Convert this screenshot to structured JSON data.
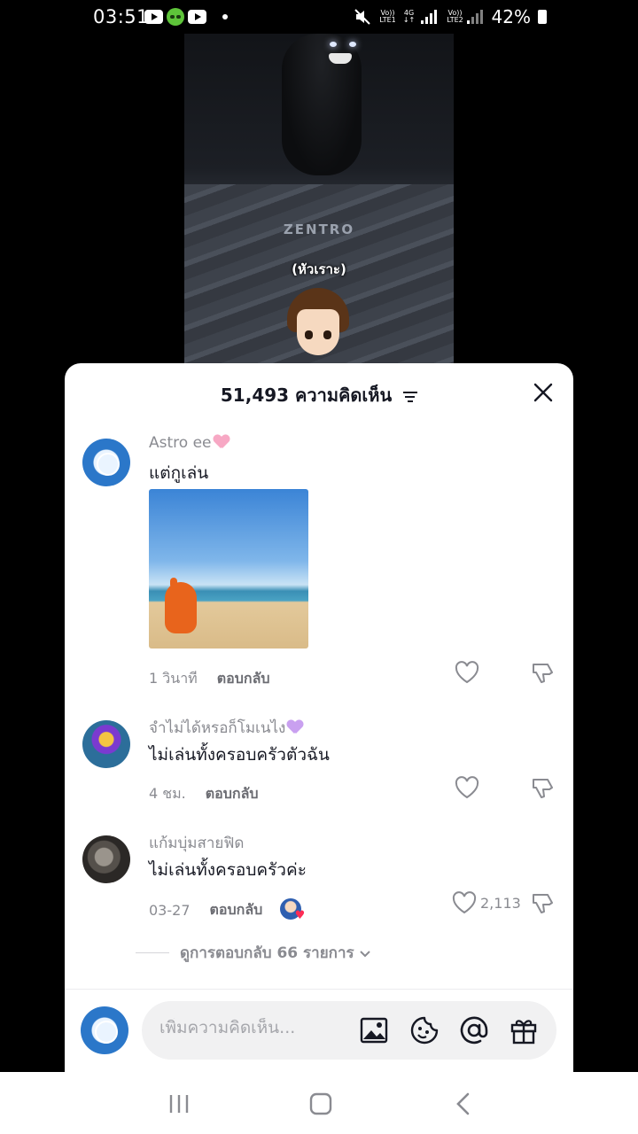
{
  "status_bar": {
    "time": "03:51",
    "battery": "42%",
    "sim1": "LTE1",
    "sim2": "LTE2",
    "net1": "4G"
  },
  "video": {
    "watermark": "ZENTRO",
    "caption": "(หัวเราะ)"
  },
  "sheet": {
    "title": "51,493 ความคิดเห็น"
  },
  "comments": [
    {
      "username": "Astro ee",
      "username_emoji": "pink-heart",
      "text": "แต่กูเล่น",
      "has_image": true,
      "time": "1 วินาที",
      "reply": "ตอบกลับ",
      "likes": ""
    },
    {
      "username": "จำไม่ได้หรอก็โมเนไง",
      "username_emoji": "purple-heart",
      "text": "ไม่เล่นทั้งครอบครัวตัวฉัน",
      "time": "4 ชม.",
      "reply": "ตอบกลับ",
      "likes": ""
    },
    {
      "username": "แก้มบุ่มสายฟิด",
      "text": "ไม่เล่นทั้งครอบครัวค่ะ",
      "time": "03-27",
      "reply": "ตอบกลับ",
      "likes": "2,113",
      "creator_liked": true
    }
  ],
  "view_replies": "ดูการตอบกลับ 66 รายการ",
  "input": {
    "placeholder": "เพิ่มความคิดเห็น..."
  },
  "colors": {
    "sheet_bg": "#ffffff",
    "text_primary": "#161823",
    "text_secondary": "#8a8b91",
    "input_bg": "#f1f1f2",
    "accent": "#fe2c55"
  }
}
